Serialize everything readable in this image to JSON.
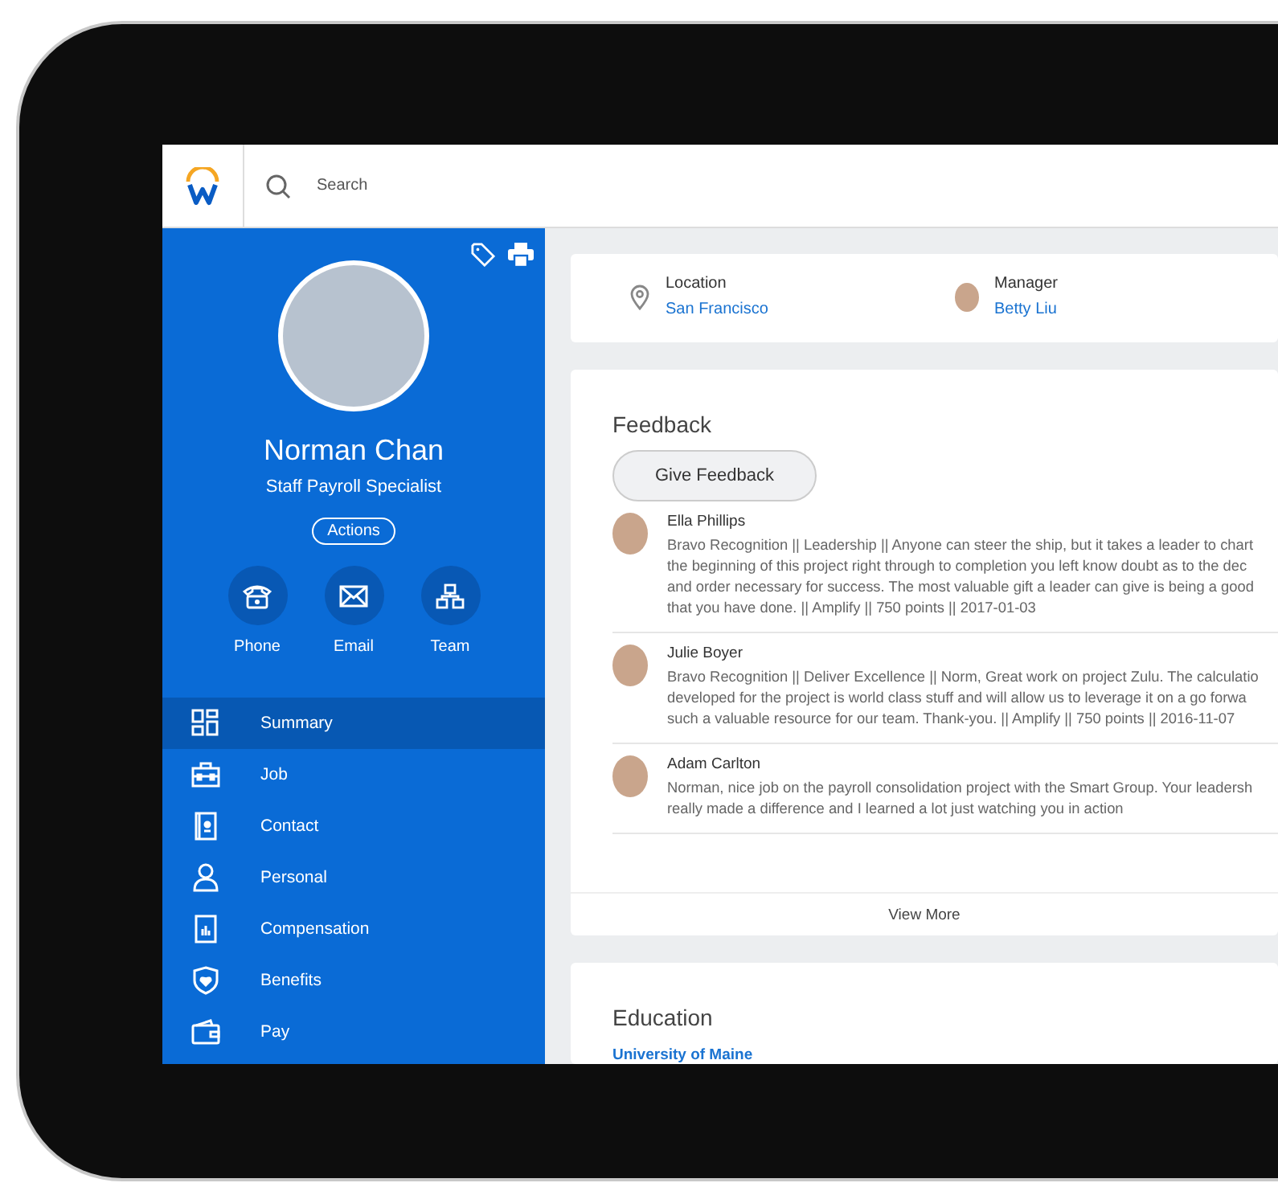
{
  "search": {
    "placeholder": "Search"
  },
  "profile": {
    "name": "Norman Chan",
    "title": "Staff Payroll Specialist",
    "actions": "Actions",
    "contacts": [
      {
        "kind": "phone",
        "label": "Phone"
      },
      {
        "kind": "email",
        "label": "Email"
      },
      {
        "kind": "team",
        "label": "Team"
      }
    ]
  },
  "nav": [
    {
      "kind": "summary",
      "label": "Summary",
      "selected": true
    },
    {
      "kind": "job",
      "label": "Job",
      "selected": false
    },
    {
      "kind": "contact",
      "label": "Contact",
      "selected": false
    },
    {
      "kind": "personal",
      "label": "Personal",
      "selected": false
    },
    {
      "kind": "compensation",
      "label": "Compensation",
      "selected": false
    },
    {
      "kind": "benefits",
      "label": "Benefits",
      "selected": false
    },
    {
      "kind": "pay",
      "label": "Pay",
      "selected": false
    }
  ],
  "info": [
    {
      "kind": "location",
      "label": "Location",
      "value": "San Francisco"
    },
    {
      "kind": "person",
      "label": "Manager",
      "value": "Betty Liu"
    }
  ],
  "feedback": {
    "title": "Feedback",
    "button": "Give Feedback",
    "view_more": "View More",
    "items": [
      {
        "name": "Ella Phillips",
        "text": "Bravo Recognition || Leadership || Anyone can steer the ship, but it takes a leader to chart the beginning of this project right through to completion you left know doubt as to the dec and order necessary for success. The most valuable gift a leader can give is being a good that you have done. || Amplify || 750 points || 2017-01-03"
      },
      {
        "name": "Julie Boyer",
        "text": "Bravo Recognition || Deliver Excellence || Norm, Great work on project Zulu. The calculatio developed for the project is world class stuff and will allow us to leverage it on a go forwa such a valuable resource for our team. Thank-you. || Amplify || 750 points || 2016-11-07"
      },
      {
        "name": "Adam Carlton",
        "text": "Norman, nice job on the payroll consolidation project with the Smart Group. Your leadersh really made a difference and I learned a lot just watching you in action"
      }
    ]
  },
  "education": {
    "title": "Education",
    "school": "University of Maine"
  }
}
